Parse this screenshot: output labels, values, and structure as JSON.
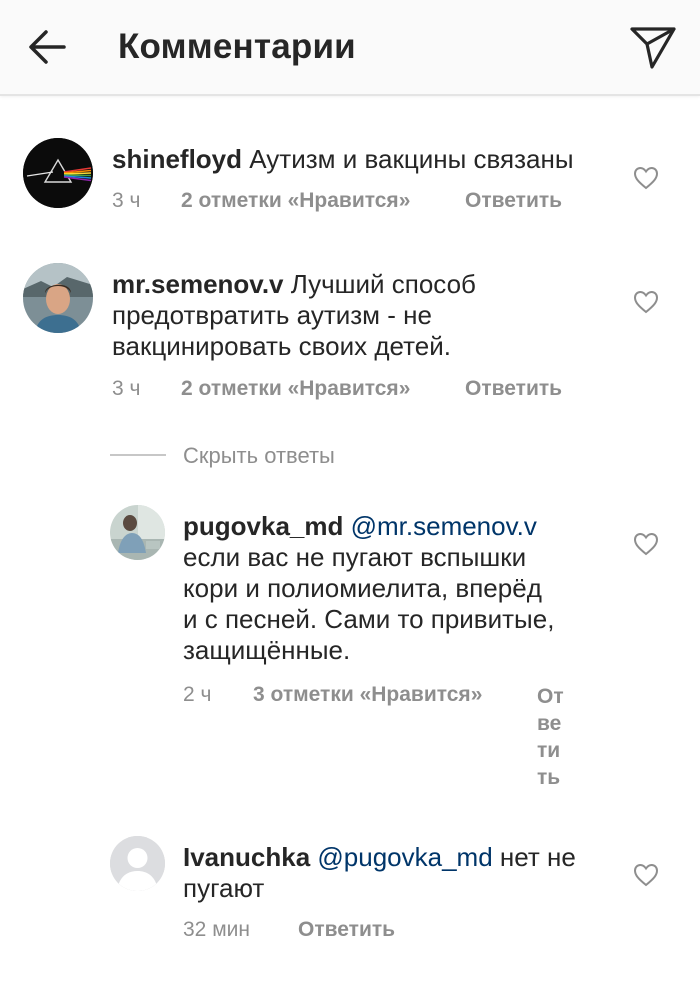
{
  "header": {
    "title": "Комментарии",
    "back_icon": "arrow-left-icon",
    "send_icon": "paper-plane-icon"
  },
  "comments": [
    {
      "username": "shinefloyd",
      "text": " Аутизм и вакцины связаны",
      "time": "3 ч",
      "likes": "2 отметки «Нравится»",
      "reply": "Ответить",
      "avatar": "prism-album-avatar"
    },
    {
      "username": "mr.semenov.v",
      "text_line1": " Лучший способ",
      "text_line2": "предотвратить аутизм - не",
      "text_line3": "вакцинировать своих детей.",
      "time": "3 ч",
      "likes": "2 отметки «Нравится»",
      "reply": "Ответить",
      "avatar": "man-photo-avatar"
    }
  ],
  "hide_replies": "Скрыть ответы",
  "replies": [
    {
      "username": "pugovka_md",
      "mention": "@mr.semenov.v",
      "text_line1": "если вас не пугают вспышки",
      "text_line2": "кори и полиомиелита, вперёд",
      "text_line3": "и с песней. Сами то привитые,",
      "text_line4": "защищённые.",
      "time": "2 ч",
      "likes": "3 отметки «Нравится»",
      "reply_parts": [
        "От",
        "ве",
        "ти",
        "ть"
      ],
      "avatar": "person-photo-avatar"
    },
    {
      "username": "Ivanuchka",
      "mention": "@pugovka_md",
      "text_line1": " нет не",
      "text_line2": "пугают",
      "time": "32 мин",
      "reply": "Ответить",
      "avatar": "default-user-avatar"
    }
  ],
  "colors": {
    "text": "#262626",
    "meta": "#8e8e8e",
    "mention": "#003569",
    "header_bg": "#fafafa"
  }
}
